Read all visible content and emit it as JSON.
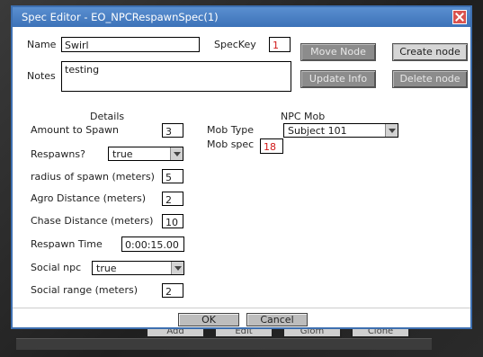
{
  "background": {
    "buttons": [
      "Add",
      "Edit",
      "Glom",
      "Clone"
    ]
  },
  "dialog": {
    "title": "Spec Editor - EO_NPCRespawnSpec(1)",
    "name_label": "Name",
    "name_value": "Swirl",
    "speckey_label": "SpecKey",
    "speckey_value": "1",
    "notes_label": "Notes",
    "notes_value": "testing",
    "buttons": {
      "move_node": "Move Node",
      "update_info": "Update Info",
      "create_node": "Create node",
      "delete_node": "Delete node"
    },
    "details_heading": "Details",
    "npc_mob_heading": "NPC Mob",
    "fields": {
      "amount_label": "Amount to Spawn",
      "amount_value": "3",
      "respawns_label": "Respawns?",
      "respawns_value": "true",
      "radius_label": "radius of spawn (meters)",
      "radius_value": "5",
      "agro_label": "Agro Distance (meters)",
      "agro_value": "2",
      "chase_label": "Chase Distance (meters)",
      "chase_value": "10",
      "respawn_time_label": "Respawn Time",
      "respawn_time_value": "0:00:15.00",
      "social_npc_label": "Social npc",
      "social_npc_value": "true",
      "social_range_label": "Social range (meters)",
      "social_range_value": "2",
      "mob_type_label": "Mob Type",
      "mob_type_value": "Subject 101",
      "mob_spec_label": "Mob spec",
      "mob_spec_value": "18"
    },
    "ok_label": "OK",
    "cancel_label": "Cancel"
  }
}
